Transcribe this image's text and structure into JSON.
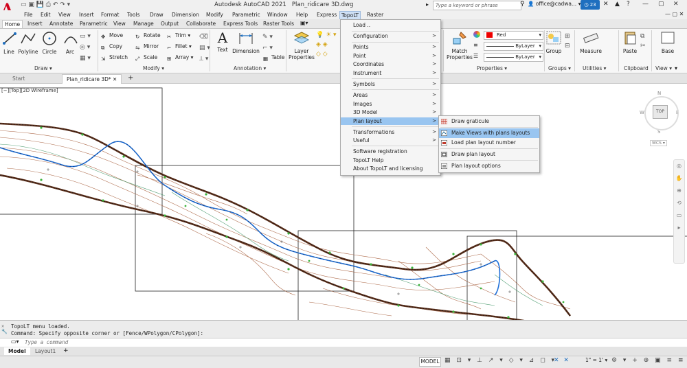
{
  "app": {
    "title": "Autodesk AutoCAD 2021",
    "document": "Plan_ridicare 3D.dwg",
    "search_placeholder": "Type a keyword or phrase",
    "user": "office@cadwa...",
    "clock_badge": "23",
    "accent_color": "#d0021b"
  },
  "menubar": [
    "File",
    "Edit",
    "View",
    "Insert",
    "Format",
    "Tools",
    "Draw",
    "Dimension",
    "Modify",
    "Parametric",
    "Window",
    "Help",
    "Express",
    "TopoLT",
    "Raster"
  ],
  "ribbon_tabs": [
    "Home",
    "Insert",
    "Annotate",
    "Parametric",
    "View",
    "Manage",
    "Output",
    "Collaborate",
    "Express Tools",
    "Raster Tools"
  ],
  "ribbon": {
    "draw": {
      "title": "Draw",
      "line": "Line",
      "polyline": "Polyline",
      "circle": "Circle",
      "arc": "Arc"
    },
    "modify": {
      "title": "Modify",
      "move": "Move",
      "rotate": "Rotate",
      "trim": "Trim",
      "copy": "Copy",
      "mirror": "Mirror",
      "fillet": "Fillet",
      "stretch": "Stretch",
      "scale": "Scale",
      "array": "Array"
    },
    "annotation": {
      "title": "Annotation",
      "text": "Text",
      "dimension": "Dimension",
      "table": "Table"
    },
    "layers": {
      "layer_properties": "Layer Properties"
    },
    "properties": {
      "title": "Properties",
      "match": "Match Properties",
      "color": "Red",
      "linetype": "ByLayer",
      "lineweight": "ByLayer"
    },
    "groups": {
      "title": "Groups",
      "group": "Group"
    },
    "utilities": {
      "title": "Utilities",
      "measure": "Measure"
    },
    "clipboard": {
      "title": "Clipboard",
      "paste": "Paste"
    },
    "view": {
      "title": "View",
      "base": "Base"
    }
  },
  "file_tabs": [
    "Start",
    "Plan_ridicare 3D*"
  ],
  "viewport_label": "[−][Top][2D Wireframe]",
  "navcube": {
    "n": "N",
    "s": "S",
    "e": "E",
    "w": "W",
    "top": "TOP",
    "wcs": "WCS"
  },
  "topolt_menu": {
    "items": [
      {
        "label": "Load ..",
        "arrow": false
      },
      {
        "label": "Configuration",
        "arrow": true
      },
      {
        "label": "Points",
        "arrow": true
      },
      {
        "label": "Point",
        "arrow": true
      },
      {
        "label": "Coordinates",
        "arrow": true
      },
      {
        "label": "Instrument",
        "arrow": true
      },
      {
        "label": "Symbols",
        "arrow": true
      },
      {
        "label": "Areas",
        "arrow": true
      },
      {
        "label": "Images",
        "arrow": true
      },
      {
        "label": "3D Model",
        "arrow": true
      },
      {
        "label": "Plan layout",
        "arrow": true
      },
      {
        "label": "Transformations",
        "arrow": true
      },
      {
        "label": "Useful",
        "arrow": true
      },
      {
        "label": "Software registration",
        "arrow": false
      },
      {
        "label": "TopoLT Help",
        "arrow": false
      },
      {
        "label": "About TopoLT and licensing",
        "arrow": false
      }
    ]
  },
  "plan_layout_submenu": [
    "Draw graticule",
    "Make Views with plans layouts",
    "Load plan layout number",
    "Draw plan layout",
    "Plan layout options"
  ],
  "command": {
    "history_1": "TopoLT menu loaded.",
    "history_2": "Command: Specify opposite corner or [Fence/WPolygon/CPolygon]:",
    "placeholder": "Type a command"
  },
  "layout_tabs": [
    "Model",
    "Layout1"
  ],
  "status": {
    "model": "MODEL",
    "scale": "1\" = 1'"
  }
}
